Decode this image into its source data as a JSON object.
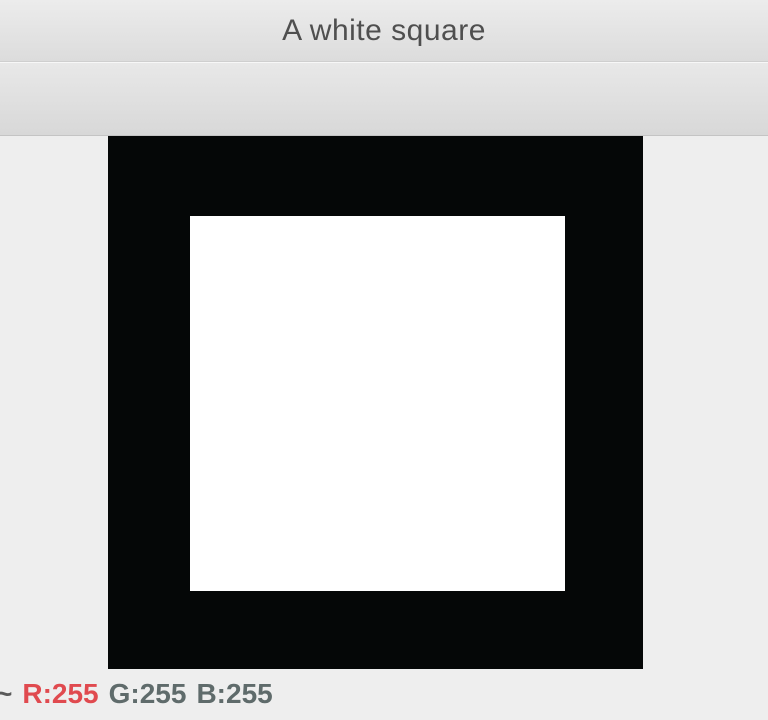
{
  "window": {
    "title": "A white square"
  },
  "status": {
    "prefix": "~",
    "r_text": "R:255",
    "g_text": "G:255",
    "b_text": "B:255",
    "colors": {
      "r": "#e04a4f",
      "g": "#5f6b6b",
      "b": "#5f6b6b"
    }
  },
  "image": {
    "outer_color": "#050707",
    "inner_color": "#ffffff"
  }
}
